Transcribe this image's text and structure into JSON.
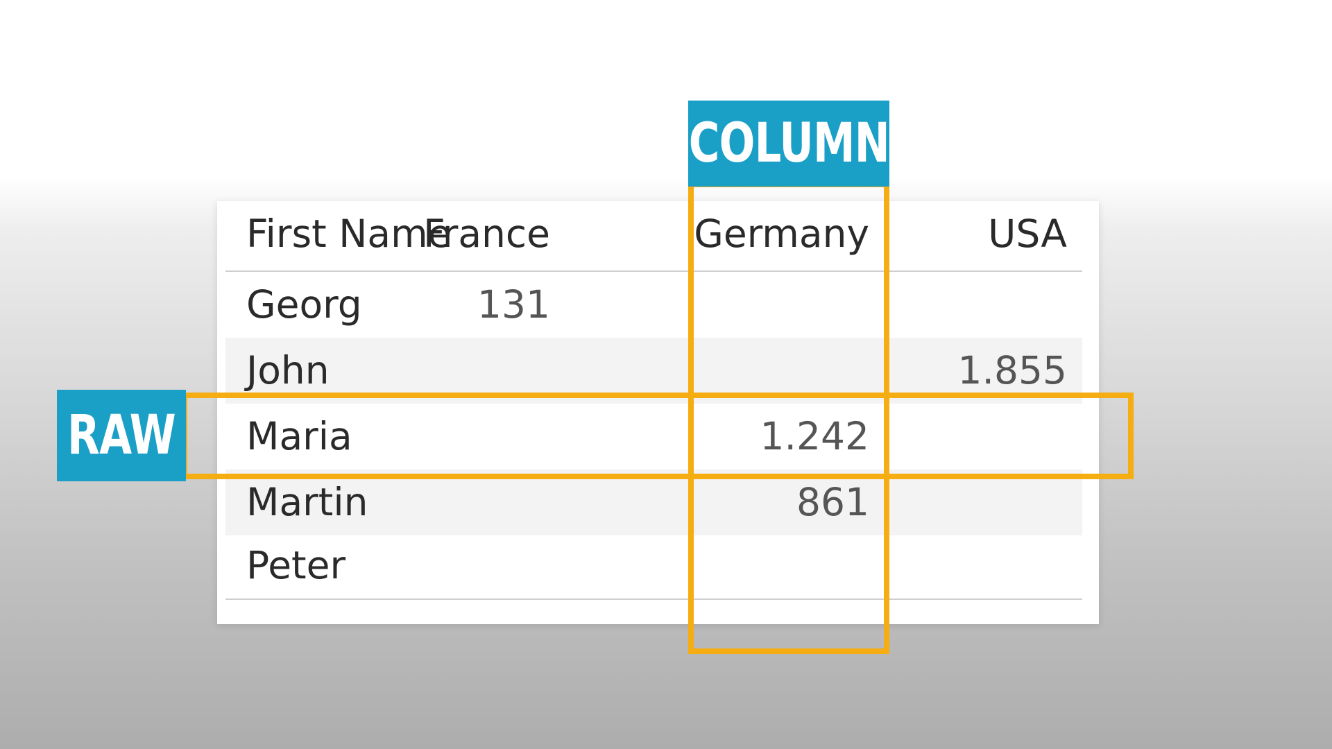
{
  "table": {
    "headers": [
      "First Name",
      "France",
      "Germany",
      "USA"
    ],
    "rows": [
      {
        "name": "Georg",
        "france": "131",
        "germany": "",
        "usa": ""
      },
      {
        "name": "John",
        "france": "",
        "germany": "",
        "usa": "1.855"
      },
      {
        "name": "Maria",
        "france": "",
        "germany": "1.242",
        "usa": ""
      },
      {
        "name": "Martin",
        "france": "",
        "germany": "861",
        "usa": ""
      },
      {
        "name": "Peter",
        "france": "",
        "germany": "",
        "usa": ""
      }
    ]
  },
  "annotations": {
    "column_label": "COLUMN",
    "row_label": "RAW",
    "highlight_color": "#f5ad11",
    "tag_color": "#1a9fc7"
  }
}
